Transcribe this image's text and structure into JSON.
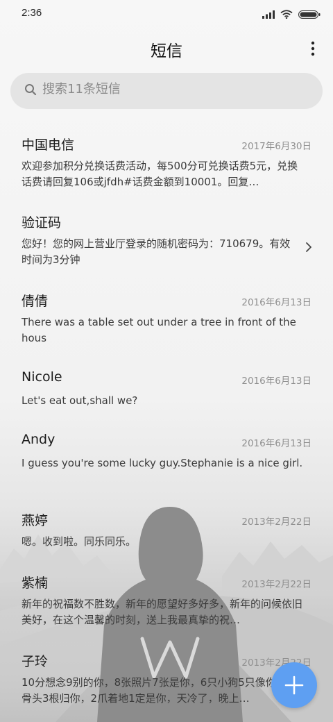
{
  "status_bar": {
    "time": "2:36",
    "icons": [
      "signal-icon",
      "wifi-icon",
      "battery-icon"
    ]
  },
  "header": {
    "title": "短信",
    "menu_icon": "more-vertical-icon"
  },
  "search": {
    "placeholder": "搜索11条短信",
    "icon": "search-icon"
  },
  "messages": [
    {
      "sender": "中国电信",
      "date": "2017年6月30日",
      "preview": "欢迎参加积分兑换话费活动，每500分可兑换话费5元，兑换话费请回复106或jfdh#话费金额到10001。回复…"
    },
    {
      "sender": "验证码",
      "date": "",
      "preview": "您好！您的网上营业厅登录的随机密码为：710679。有效时间为3分钟",
      "has_chevron": true
    },
    {
      "sender": "倩倩",
      "date": "2016年6月13日",
      "preview": "There was a table set out under a tree in front of the hous"
    },
    {
      "sender": "Nicole",
      "date": "2016年6月13日",
      "preview": "Let's eat out,shall we?"
    },
    {
      "sender": "Andy",
      "date": "2016年6月13日",
      "preview": "I guess you're some lucky guy.Stephanie is a nice girl."
    },
    {
      "sender": "燕婷",
      "date": "2013年2月22日",
      "preview": "嗯。收到啦。同乐同乐。"
    },
    {
      "sender": "紫楠",
      "date": "2013年2月22日",
      "preview": "新年的祝福数不胜数，新年的愿望好多好多，新年的问候依旧美好，在这个温馨的时刻，送上我最真挚的祝…"
    },
    {
      "sender": "子玲",
      "date": "2013年2月22日",
      "preview": "10分想念9别的你，8张照片7张是你，6只小狗5只像你，4根骨头3根归你，2爪着地1定是你，天冷了，晚上…"
    }
  ],
  "fab": {
    "icon": "plus-icon",
    "color": "#5E9FF2"
  },
  "colors": {
    "background": "#F7F7F7",
    "search_background": "#E4E4E4",
    "date_text": "#8F8F8F",
    "accent": "#5E9FF2"
  }
}
